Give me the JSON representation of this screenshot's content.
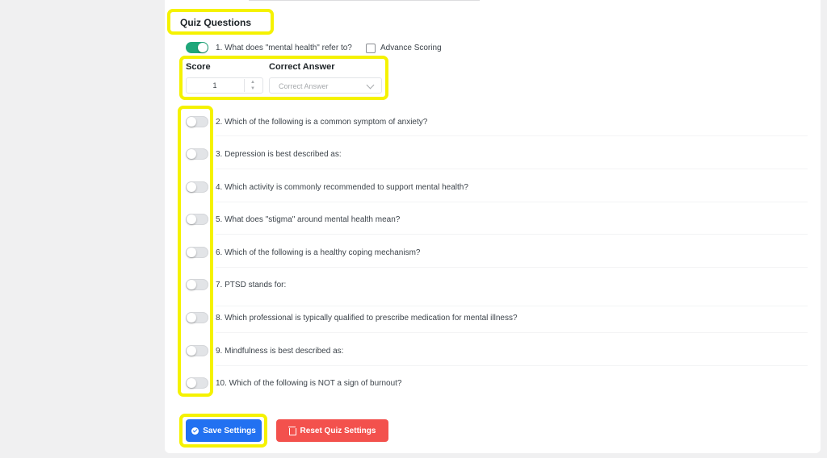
{
  "section": {
    "title": "Quiz Questions"
  },
  "question1": {
    "label": "1. What does \"mental health\" refer to?",
    "enabled": true,
    "advance_scoring_label": "Advance Scoring",
    "advance_scoring_checked": false,
    "score_label": "Score",
    "score_value": "1",
    "correct_answer_label": "Correct Answer",
    "correct_answer_placeholder": "Correct Answer"
  },
  "questions": [
    {
      "label": "2. Which of the following is a common symptom of anxiety?",
      "enabled": false
    },
    {
      "label": "3. Depression is best described as:",
      "enabled": false
    },
    {
      "label": "4. Which activity is commonly recommended to support mental health?",
      "enabled": false
    },
    {
      "label": "5. What does \"stigma\" around mental health mean?",
      "enabled": false
    },
    {
      "label": "6. Which of the following is a healthy coping mechanism?",
      "enabled": false
    },
    {
      "label": "7. PTSD stands for:",
      "enabled": false
    },
    {
      "label": "8. Which professional is typically qualified to prescribe medication for mental illness?",
      "enabled": false
    },
    {
      "label": "9. Mindfulness is best described as:",
      "enabled": false
    },
    {
      "label": "10. Which of the following is NOT a sign of burnout?",
      "enabled": false
    }
  ],
  "actions": {
    "save_label": "Save Settings",
    "reset_label": "Reset Quiz Settings"
  },
  "colors": {
    "toggle_on": "#1fa67a",
    "save_button": "#2271f1",
    "reset_button": "#f3514d",
    "highlight": "#f5f200"
  }
}
